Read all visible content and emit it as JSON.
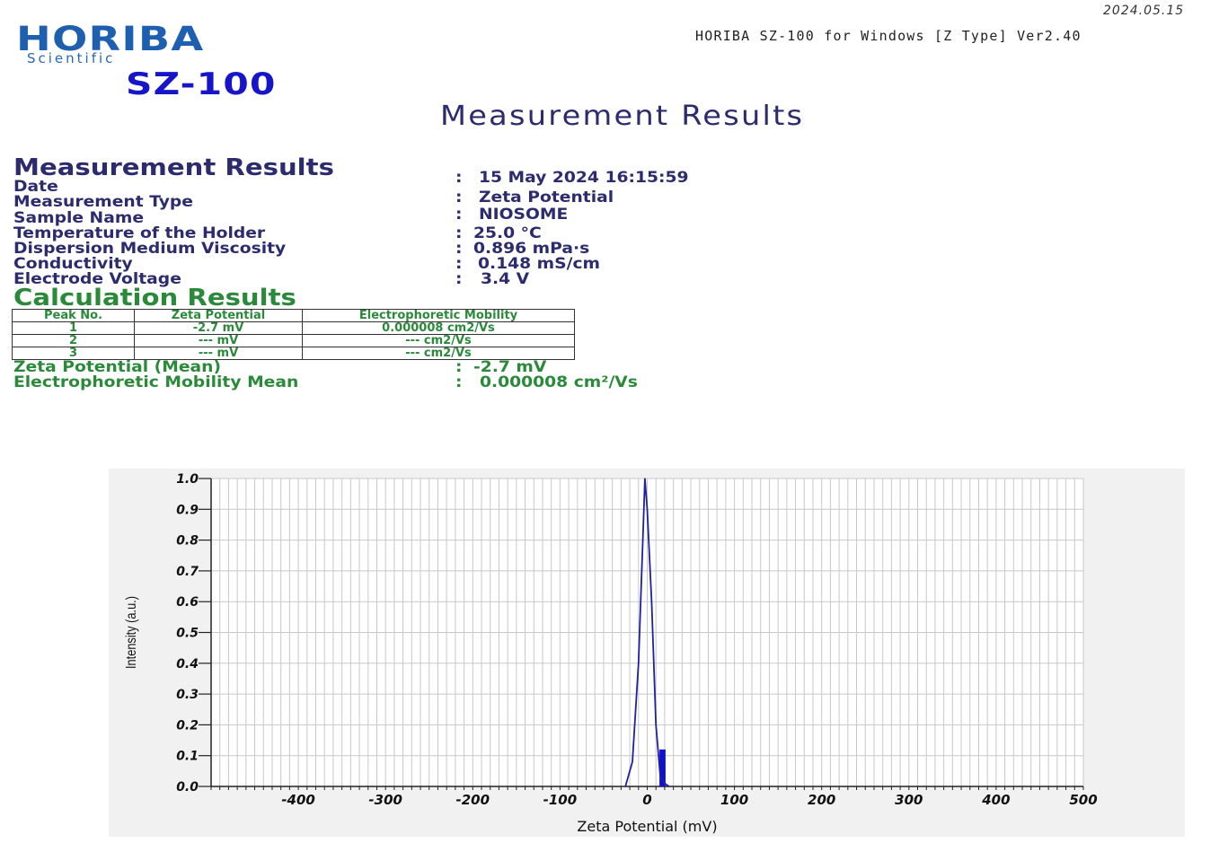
{
  "header": {
    "report_date": "2024.05.15",
    "software_version": "HORIBA SZ-100 for Windows [Z Type] Ver2.40",
    "brand_name": "HORIBA",
    "brand_sub": "Scientific",
    "model_name": "SZ-100",
    "page_title": "Measurement Results"
  },
  "measurement": {
    "section_title": "Measurement Results",
    "separator": ":",
    "fields": [
      {
        "label": "Date",
        "value": "15 May 2024 16:15:59"
      },
      {
        "label": "Measurement Type",
        "value": "Zeta Potential"
      },
      {
        "label": "Sample Name",
        "value": "NIOSOME"
      },
      {
        "label": "Temperature of the Holder",
        "value": "25.0 °C"
      },
      {
        "label": "Dispersion Medium Viscosity",
        "value": "0.896 mPa·s"
      },
      {
        "label": "Conductivity",
        "value": "0.148 mS/cm"
      },
      {
        "label": "Electrode Voltage",
        "value": "3.4 V"
      }
    ]
  },
  "calculation": {
    "section_title": "Calculation Results",
    "table": {
      "headers": [
        "Peak No.",
        "Zeta Potential",
        "Electrophoretic Mobility"
      ],
      "rows": [
        [
          "1",
          "-2.7 mV",
          "0.000008 cm2/Vs"
        ],
        [
          "2",
          "--- mV",
          "--- cm2/Vs"
        ],
        [
          "3",
          "--- mV",
          "--- cm2/Vs"
        ]
      ]
    },
    "zeta_mean_label": "Zeta Potential (Mean)",
    "zeta_mean_value": "-2.7 mV",
    "mobility_mean_label": "Electrophoretic Mobility Mean",
    "mobility_mean_value": "0.000008 cm²/Vs"
  },
  "colors": {
    "navy_text": "#2b2b6e",
    "green_text": "#2a8a3a",
    "brand_blue": "#1e5fb0",
    "model_blue": "#1616c8",
    "curve": "#2020a0",
    "bar": "#1010d0",
    "chart_bg": "#f1f1f1",
    "grid": "#c8c8c8"
  },
  "chart_data": {
    "type": "line",
    "xlabel": "Zeta Potential (mV)",
    "ylabel": "Intensity (a.u.)",
    "xlim": [
      -500,
      500
    ],
    "ylim": [
      0.0,
      1.0
    ],
    "x_ticks": [
      -400,
      -300,
      -200,
      -100,
      0,
      100,
      200,
      300,
      400,
      500
    ],
    "y_ticks": [
      "0.0",
      "0.1",
      "0.2",
      "0.3",
      "0.4",
      "0.5",
      "0.6",
      "0.7",
      "0.8",
      "0.9",
      "1.0"
    ],
    "grid": true,
    "series": [
      {
        "x": [
          -25,
          -17,
          -10,
          -5,
          -2.7,
          0,
          5,
          10,
          15,
          20,
          25
        ],
        "y": [
          0.0,
          0.08,
          0.4,
          0.8,
          1.0,
          0.9,
          0.6,
          0.2,
          0.03,
          0.01,
          0.0
        ]
      }
    ],
    "bars": [
      {
        "x0": 14,
        "x1": 21,
        "y": 0.12
      }
    ]
  }
}
